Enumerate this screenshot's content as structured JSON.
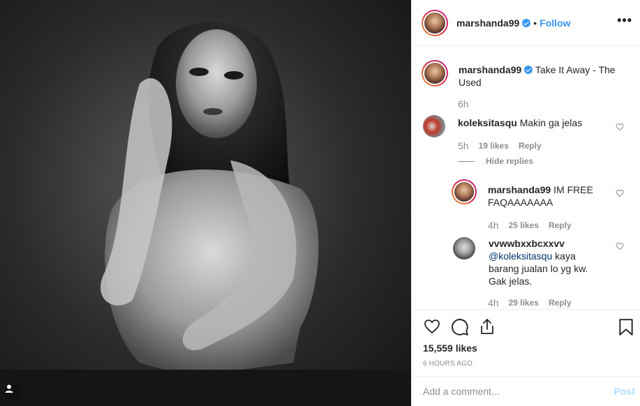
{
  "post": {
    "username": "marshanda99",
    "follow_label": "Follow",
    "dot": "•",
    "more_label": "•••"
  },
  "caption": {
    "username": "marshanda99",
    "text": "Take It Away - The Used",
    "time": "6h"
  },
  "comments": [
    {
      "username": "koleksitasqu",
      "text": "Makin ga jelas",
      "time": "5h",
      "likes": "19 likes",
      "reply_label": "Reply"
    }
  ],
  "hide_replies_label": "Hide replies",
  "replies": [
    {
      "username": "marshanda99",
      "text": "IM FREE FAQAAAAAAA",
      "time": "4h",
      "likes": "25 likes",
      "reply_label": "Reply"
    },
    {
      "username": "vvwwbxxbcxxvv",
      "mention": "@koleksitasqu",
      "text": "kaya barang jualan lo yg kw. Gak jelas.",
      "time": "4h",
      "likes": "29 likes",
      "reply_label": "Reply"
    }
  ],
  "stats": {
    "likes": "15,559 likes",
    "posted_ago": "6 HOURS AGO"
  },
  "add_comment": {
    "placeholder": "Add a comment...",
    "post_label": "Post"
  },
  "icons": {
    "heart": "heart-icon",
    "comment": "comment-icon",
    "share": "share-icon",
    "bookmark": "bookmark-icon",
    "user_tag": "user-tag-icon",
    "verified": "verified-badge-icon"
  },
  "colors": {
    "accent": "#3897f0",
    "muted": "#8e8e8e",
    "text": "#262626",
    "post_disabled": "#b2dffc"
  }
}
